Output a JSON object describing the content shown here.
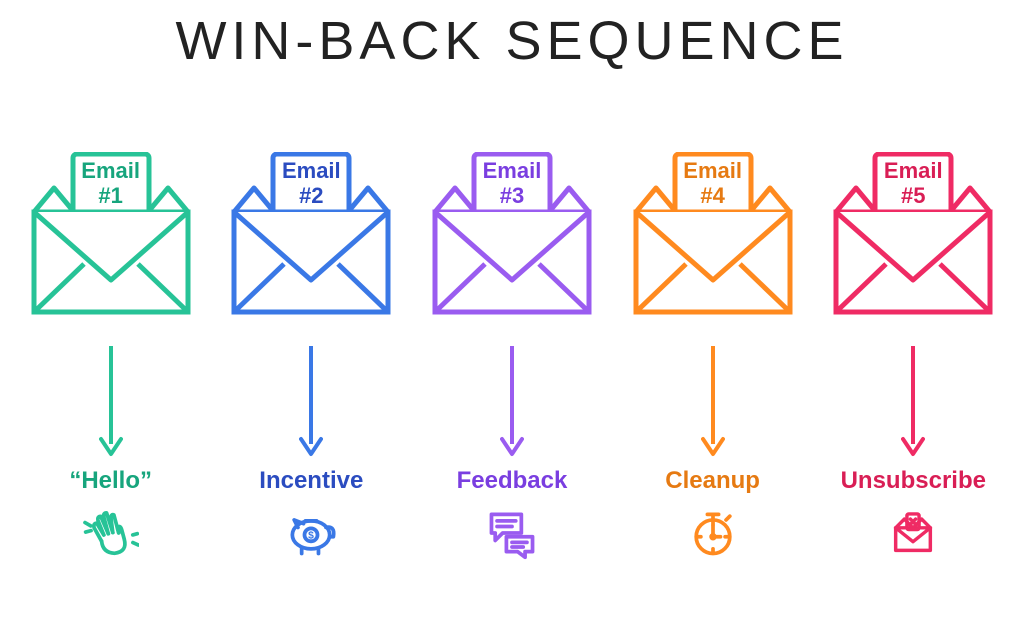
{
  "title": "WIN-BACK SEQUENCE",
  "steps": [
    {
      "color": "#27c397",
      "text_color": "#17a57d",
      "card_line1": "Email",
      "card_line2": "#1",
      "label": "“Hello”",
      "icon": "wave"
    },
    {
      "color": "#3a78e6",
      "text_color": "#2b4cc0",
      "card_line1": "Email",
      "card_line2": "#2",
      "label": "Incentive",
      "icon": "piggy"
    },
    {
      "color": "#9a5cf0",
      "text_color": "#7a3ee0",
      "card_line1": "Email",
      "card_line2": "#3",
      "label": "Feedback",
      "icon": "chat"
    },
    {
      "color": "#ff8a1f",
      "text_color": "#e67a12",
      "card_line1": "Email",
      "card_line2": "#4",
      "label": "Cleanup",
      "icon": "stopwatch"
    },
    {
      "color": "#ef2b64",
      "text_color": "#d91e55",
      "card_line1": "Email",
      "card_line2": "#5",
      "label": "Unsubscribe",
      "icon": "unsub"
    }
  ]
}
